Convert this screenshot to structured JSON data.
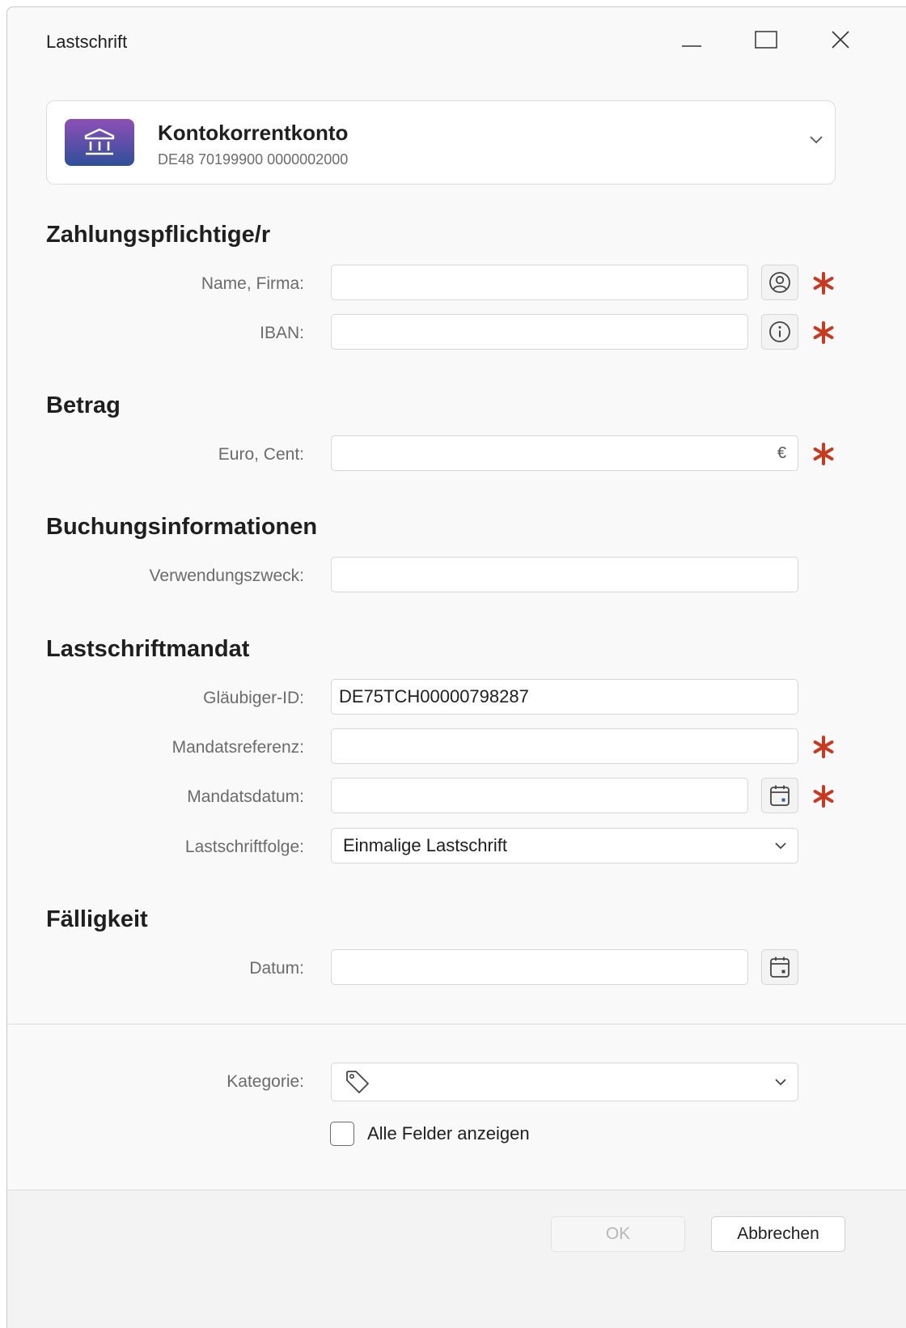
{
  "window": {
    "title": "Lastschrift"
  },
  "account": {
    "name": "Kontokorrentkonto",
    "iban": "DE48 70199900 0000002000",
    "icon": "bank-icon"
  },
  "sections": {
    "payer": "Zahlungspflichtige/r",
    "amount": "Betrag",
    "booking": "Buchungsinformationen",
    "mandate": "Lastschriftmandat",
    "due": "Fälligkeit"
  },
  "fields": {
    "name": {
      "label": "Name, Firma:",
      "value": ""
    },
    "iban": {
      "label": "IBAN:",
      "value": ""
    },
    "amount": {
      "label": "Euro, Cent:",
      "value": "",
      "currency": "€"
    },
    "purpose": {
      "label": "Verwendungszweck:",
      "value": ""
    },
    "creditor_id": {
      "label": "Gläubiger-ID:",
      "value": "DE75TCH00000798287"
    },
    "mandate_ref": {
      "label": "Mandatsreferenz:",
      "value": ""
    },
    "mandate_date": {
      "label": "Mandatsdatum:",
      "value": ""
    },
    "sequence": {
      "label": "Lastschriftfolge:",
      "value": "Einmalige Lastschrift"
    },
    "due_date": {
      "label": "Datum:",
      "value": ""
    },
    "category": {
      "label": "Kategorie:",
      "value": ""
    }
  },
  "show_all_fields": {
    "label": "Alle Felder anzeigen",
    "checked": false
  },
  "buttons": {
    "ok": "OK",
    "cancel": "Abbrechen"
  },
  "colors": {
    "required": "#c8391f",
    "accent_gradient_top": "#8e4fb6",
    "accent_gradient_bottom": "#2f4f98"
  }
}
